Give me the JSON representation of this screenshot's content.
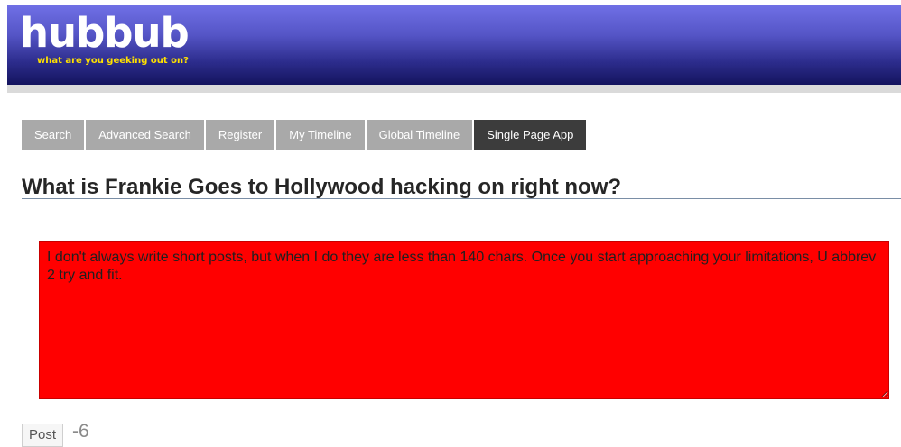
{
  "header": {
    "logo": "hubbub",
    "tagline": "what are you geeking out on?"
  },
  "nav": {
    "items": [
      {
        "label": "Search"
      },
      {
        "label": "Advanced Search"
      },
      {
        "label": "Register"
      },
      {
        "label": "My Timeline"
      },
      {
        "label": "Global Timeline"
      },
      {
        "label": "Single Page App",
        "active": true
      }
    ]
  },
  "main": {
    "title": "What is Frankie Goes to Hollywood hacking on right now?",
    "post_text": "I don't always write short posts, but when I do they are less than 140 chars. Once you start approaching your limitations, U abbrev 2 try and fit.",
    "post_button_label": "Post",
    "char_count": "-6"
  },
  "colors": {
    "header_top": "#7070e6",
    "header_bottom": "#14145e",
    "tagline": "#ffe100",
    "nav_inactive": "#a9a9a9",
    "nav_active": "#3c3c3c",
    "post_box_over_limit": "#ff0000"
  }
}
